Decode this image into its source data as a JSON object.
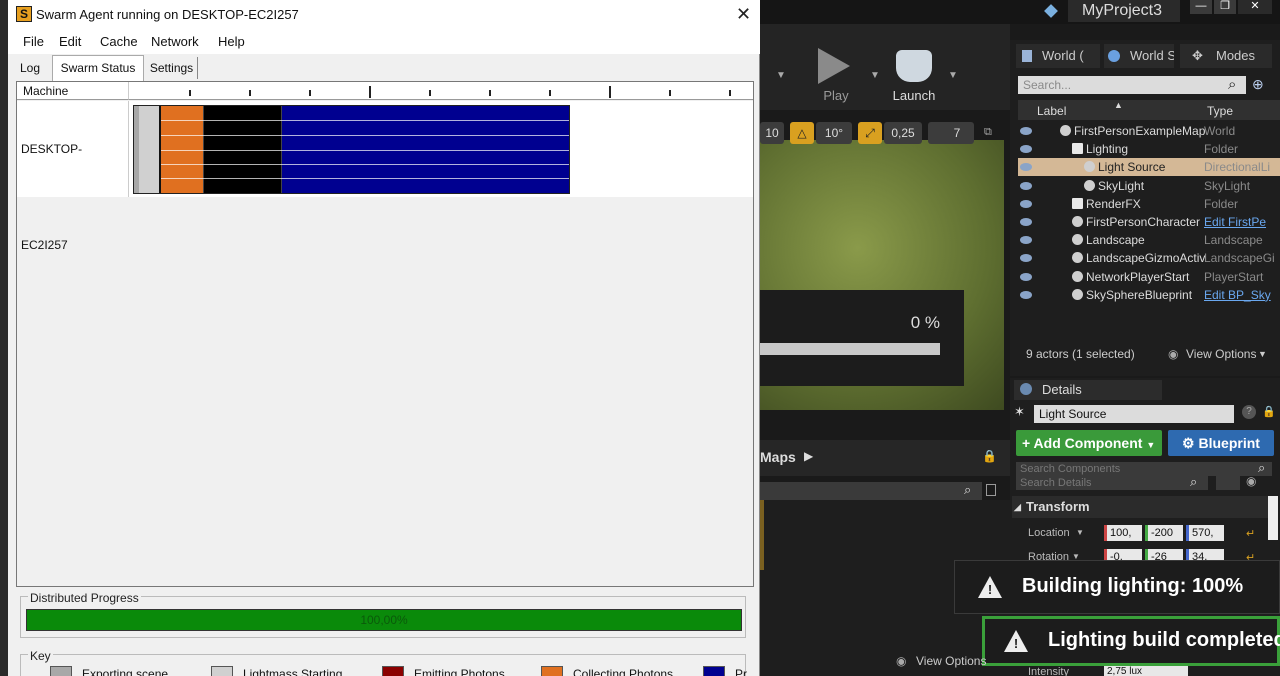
{
  "swarm": {
    "title": "Swarm Agent running on DESKTOP-EC2I257",
    "icon_letter": "S",
    "menu": [
      "File",
      "Edit",
      "Cache",
      "Network",
      "Help"
    ],
    "tabs": [
      "Log",
      "Swarm Status",
      "Settings"
    ],
    "active_tab": "Swarm Status",
    "machine_header": "Machine",
    "machine_name": "DESKTOP-EC2I257",
    "distributed_label": "Distributed Progress",
    "distributed_value": "100,00%",
    "distributed_progress": 1.0,
    "key_label": "Key",
    "key_items": [
      {
        "label": "Exporting scene",
        "color": "#a8a8a8"
      },
      {
        "label": "Lightmass Starting",
        "color": "#d0d0d0"
      },
      {
        "label": "Emitting Photons",
        "color": "#8b0000"
      },
      {
        "label": "Collecting Photons",
        "color": "#e07020"
      },
      {
        "label": "Pr",
        "color": "#000090"
      }
    ],
    "timeline_segments": [
      {
        "phase": "Exporting scene",
        "color": "#a8a8a8"
      },
      {
        "phase": "Lightmass Starting",
        "color": "#d0d0d0"
      },
      {
        "phase": "Collecting Photons",
        "color": "#e07020"
      },
      {
        "phase": "",
        "color": "#000000"
      },
      {
        "phase": "",
        "color": "#000090"
      }
    ]
  },
  "ue": {
    "project": "MyProject3",
    "toolbar": {
      "play": "Play",
      "launch": "Launch"
    },
    "viewport_buttons": [
      "10",
      "10°",
      "0,25",
      "7"
    ],
    "build_progress_text": "0 %",
    "maps_label": "Maps",
    "outliner": {
      "tabs": [
        "World (",
        "World S",
        "Modes"
      ],
      "search_placeholder": "Search...",
      "col_label": "Label",
      "col_type": "Type",
      "rows": [
        {
          "label": "FirstPersonExampleMap",
          "type": "World",
          "link": false,
          "indent": 1,
          "selected": false
        },
        {
          "label": "Lighting",
          "type": "Folder",
          "link": false,
          "indent": 2,
          "selected": false
        },
        {
          "label": "Light Source",
          "type": "DirectionalLi",
          "link": false,
          "indent": 3,
          "selected": true
        },
        {
          "label": "SkyLight",
          "type": "SkyLight",
          "link": false,
          "indent": 3,
          "selected": false
        },
        {
          "label": "RenderFX",
          "type": "Folder",
          "link": false,
          "indent": 2,
          "selected": false
        },
        {
          "label": "FirstPersonCharacter",
          "type": "Edit FirstPe",
          "link": true,
          "indent": 2,
          "selected": false
        },
        {
          "label": "Landscape",
          "type": "Landscape",
          "link": false,
          "indent": 2,
          "selected": false
        },
        {
          "label": "LandscapeGizmoActiv",
          "type": "LandscapeGi",
          "link": false,
          "indent": 2,
          "selected": false
        },
        {
          "label": "NetworkPlayerStart",
          "type": "PlayerStart",
          "link": false,
          "indent": 2,
          "selected": false
        },
        {
          "label": "SkySphereBlueprint",
          "type": "Edit BP_Sky",
          "link": true,
          "indent": 2,
          "selected": false
        }
      ],
      "actor_count": "9 actors (1 selected)",
      "view_options": "View Options"
    },
    "details": {
      "tab": "Details",
      "object_name": "Light Source",
      "add_component": "Add Component",
      "blueprint": "Blueprint",
      "search_components": "Search Components",
      "search_details": "Search Details",
      "transform": "Transform",
      "location": "Location",
      "rotation": "Rotation",
      "location_values": [
        "100,",
        "-200",
        "570,"
      ],
      "rotation_values": [
        "-0,",
        "-26",
        "34,"
      ],
      "intensity": "Intensity",
      "intensity_value": "2,75 lux",
      "view_options": "View Options"
    },
    "notifications": {
      "building": "Building lighting:  100%",
      "completed": "Lighting build completed"
    }
  }
}
